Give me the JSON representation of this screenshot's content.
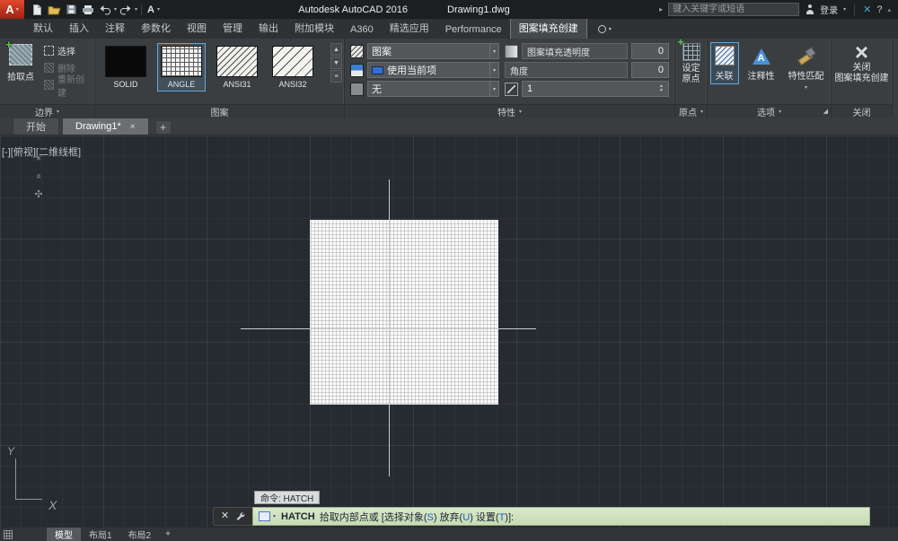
{
  "colors": {
    "logo_red": "#c5321f",
    "selection_blue": "#5fa8d8",
    "command_bar_green": "#cfe0c1",
    "keyword_blue": "#1f5fd0",
    "canvas_bg": "#262b31"
  },
  "titlebar": {
    "app_name": "Autodesk AutoCAD 2016",
    "doc_name": "Drawing1.dwg",
    "search_placeholder": "键入关键字或短语",
    "signin": "登录"
  },
  "ribbon_tabs": {
    "t0": "默认",
    "t1": "插入",
    "t2": "注释",
    "t3": "参数化",
    "t4": "视图",
    "t5": "管理",
    "t6": "输出",
    "t7": "附加模块",
    "t8": "A360",
    "t9": "精选应用",
    "t10": "Performance",
    "active": "图案填充创建"
  },
  "boundary_panel": {
    "pick_points": "拾取点",
    "select": "选择",
    "remove": "删除",
    "recreate": "重新创建",
    "footer": "边界"
  },
  "pattern_panel": {
    "s0": "SOLID",
    "s1": "ANGLE",
    "s2": "ANSI31",
    "s3": "ANSI32",
    "selected": "ANGLE",
    "footer": "图案"
  },
  "properties_panel": {
    "pattern_type": "图案",
    "color": "使用当前项",
    "background": "无",
    "transparency_label": "图案填充透明度",
    "transparency_value": "0",
    "angle_label": "角度",
    "angle_value": "0",
    "scale_value": "1",
    "footer": "特性"
  },
  "origin_panel": {
    "line1": "设定",
    "line2": "原点",
    "footer": "原点"
  },
  "options_panel": {
    "associative": "关联",
    "annotative": "注释性",
    "match_properties": "特性匹配",
    "footer": "选项"
  },
  "close_panel": {
    "line1": "关闭",
    "line2": "图案填充创建",
    "footer": "关闭"
  },
  "file_tabs": {
    "start": "开始",
    "drawing": "Drawing1*"
  },
  "viewport": {
    "controls_label": "[-][俯视][二维线框]",
    "ucs_x": "X",
    "ucs_y": "Y",
    "tooltip": "命令: HATCH"
  },
  "command_line": {
    "command": "HATCH",
    "seg1": "拾取内部点或 [选择对象(",
    "key1": "S",
    "seg2": ") 放弃(",
    "key2": "U",
    "seg3": ") 设置(",
    "key3": "T",
    "seg4": ")]:"
  },
  "layout_bar": {
    "model": "模型",
    "layout1": "布局1",
    "layout2": "布局2"
  }
}
